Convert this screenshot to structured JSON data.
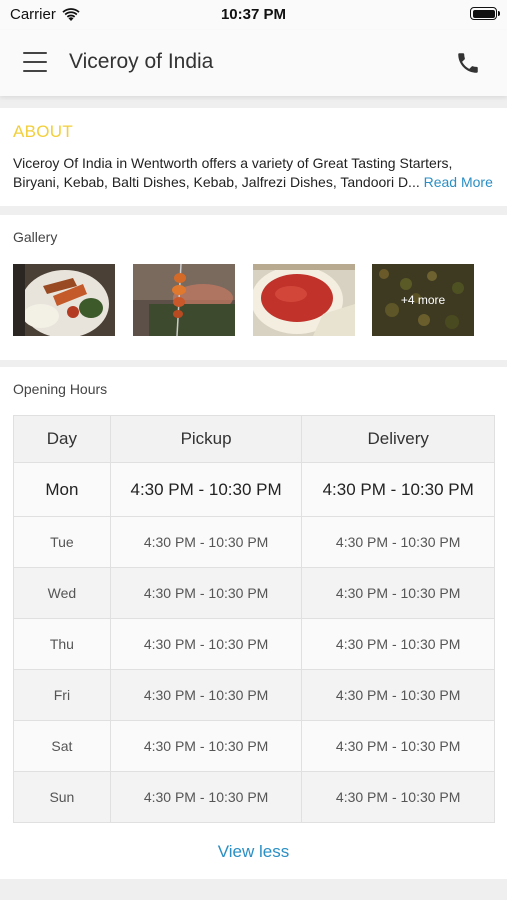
{
  "status_bar": {
    "carrier": "Carrier",
    "time": "10:37 PM"
  },
  "nav": {
    "title": "Viceroy of India",
    "menu_icon": "hamburger-icon",
    "call_icon": "phone-icon"
  },
  "about": {
    "heading": "ABOUT",
    "line1": "Viceroy Of India in Wentworth offers a variety of Great Tasting Starters,",
    "line2": "Biryani, Kebab, Balti Dishes, Kebab, Jalfrezi Dishes, Tandoori D...",
    "read_more": "Read More"
  },
  "gallery": {
    "heading": "Gallery",
    "more_label": "+4 more"
  },
  "hours": {
    "heading": "Opening Hours",
    "columns": [
      "Day",
      "Pickup",
      "Delivery"
    ],
    "rows": [
      {
        "day": "Mon",
        "pickup": "4:30 PM - 10:30 PM",
        "delivery": "4:30 PM - 10:30 PM"
      },
      {
        "day": "Tue",
        "pickup": "4:30 PM - 10:30 PM",
        "delivery": "4:30 PM - 10:30 PM"
      },
      {
        "day": "Wed",
        "pickup": "4:30 PM - 10:30 PM",
        "delivery": "4:30 PM - 10:30 PM"
      },
      {
        "day": "Thu",
        "pickup": "4:30 PM - 10:30 PM",
        "delivery": "4:30 PM - 10:30 PM"
      },
      {
        "day": "Fri",
        "pickup": "4:30 PM - 10:30 PM",
        "delivery": "4:30 PM - 10:30 PM"
      },
      {
        "day": "Sat",
        "pickup": "4:30 PM - 10:30 PM",
        "delivery": "4:30 PM - 10:30 PM"
      },
      {
        "day": "Sun",
        "pickup": "4:30 PM - 10:30 PM",
        "delivery": "4:30 PM - 10:30 PM"
      }
    ],
    "view_less": "View less"
  },
  "colors": {
    "accent_yellow": "#f2cf3a",
    "link_blue": "#2a8fc4"
  }
}
